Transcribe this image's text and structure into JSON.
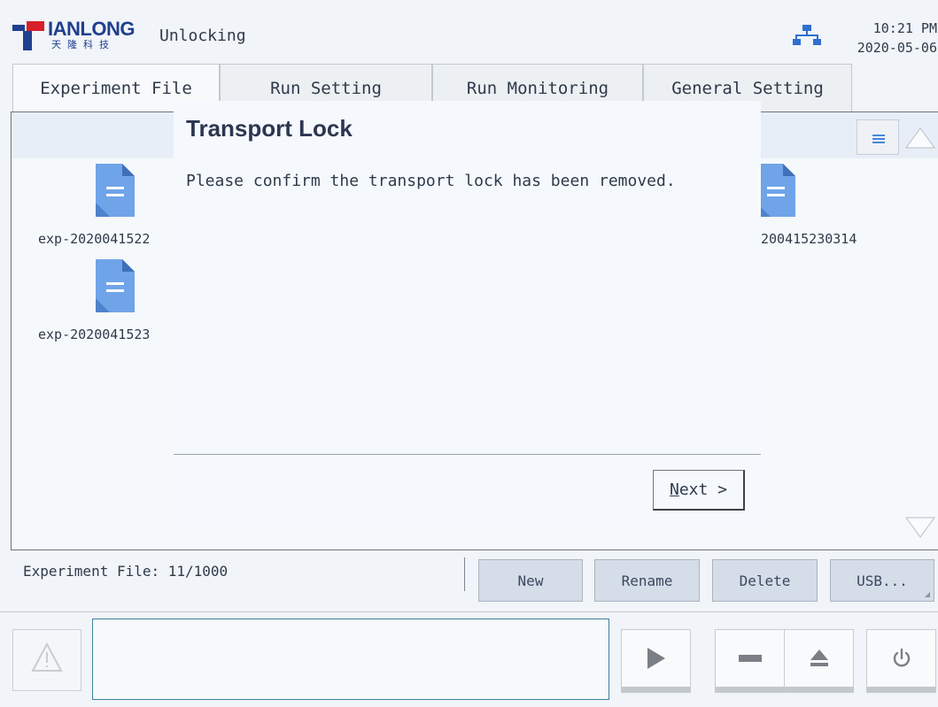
{
  "header": {
    "logo_name": "IANLONG",
    "logo_subtitle": "天隆科技",
    "status": "Unlocking",
    "time": "10:21 PM",
    "date": "2020-05-06",
    "network_icon": "network-icon"
  },
  "tabs": [
    {
      "label": "Experiment File",
      "selected": true
    },
    {
      "label": "Run Setting",
      "selected": false
    },
    {
      "label": "Run Monitoring",
      "selected": false
    },
    {
      "label": "General Setting",
      "selected": false
    }
  ],
  "content": {
    "files": [
      {
        "label": "exp-2020041522"
      },
      {
        "label": "exp-2020041523"
      },
      {
        "label": "200415230314"
      }
    ],
    "list_view_icon": "list-icon",
    "scroll_up_icon": "triangle-up-icon",
    "scroll_down_icon": "triangle-down-icon"
  },
  "dialog": {
    "title": "Transport Lock",
    "message": "Please confirm the transport lock has been removed.",
    "next_label_mnemonic": "N",
    "next_label_rest": "ext >"
  },
  "file_toolbar": {
    "count_text": "Experiment File: 11/1000",
    "buttons": {
      "new": "New",
      "rename": "Rename",
      "delete": "Delete",
      "usb": "USB..."
    }
  },
  "bottom_bar": {
    "warning_icon": "warning-icon",
    "controls": [
      "play-icon",
      "stop-icon",
      "eject-icon",
      "power-icon"
    ]
  },
  "colors": {
    "background": "#f1f4f8",
    "brand_blue": "#1f3f8f",
    "brand_red": "#d8202a",
    "button_fill": "#d4dde8",
    "accent_border": "#3f7fa2",
    "file_icon": "#6fa4e8"
  }
}
